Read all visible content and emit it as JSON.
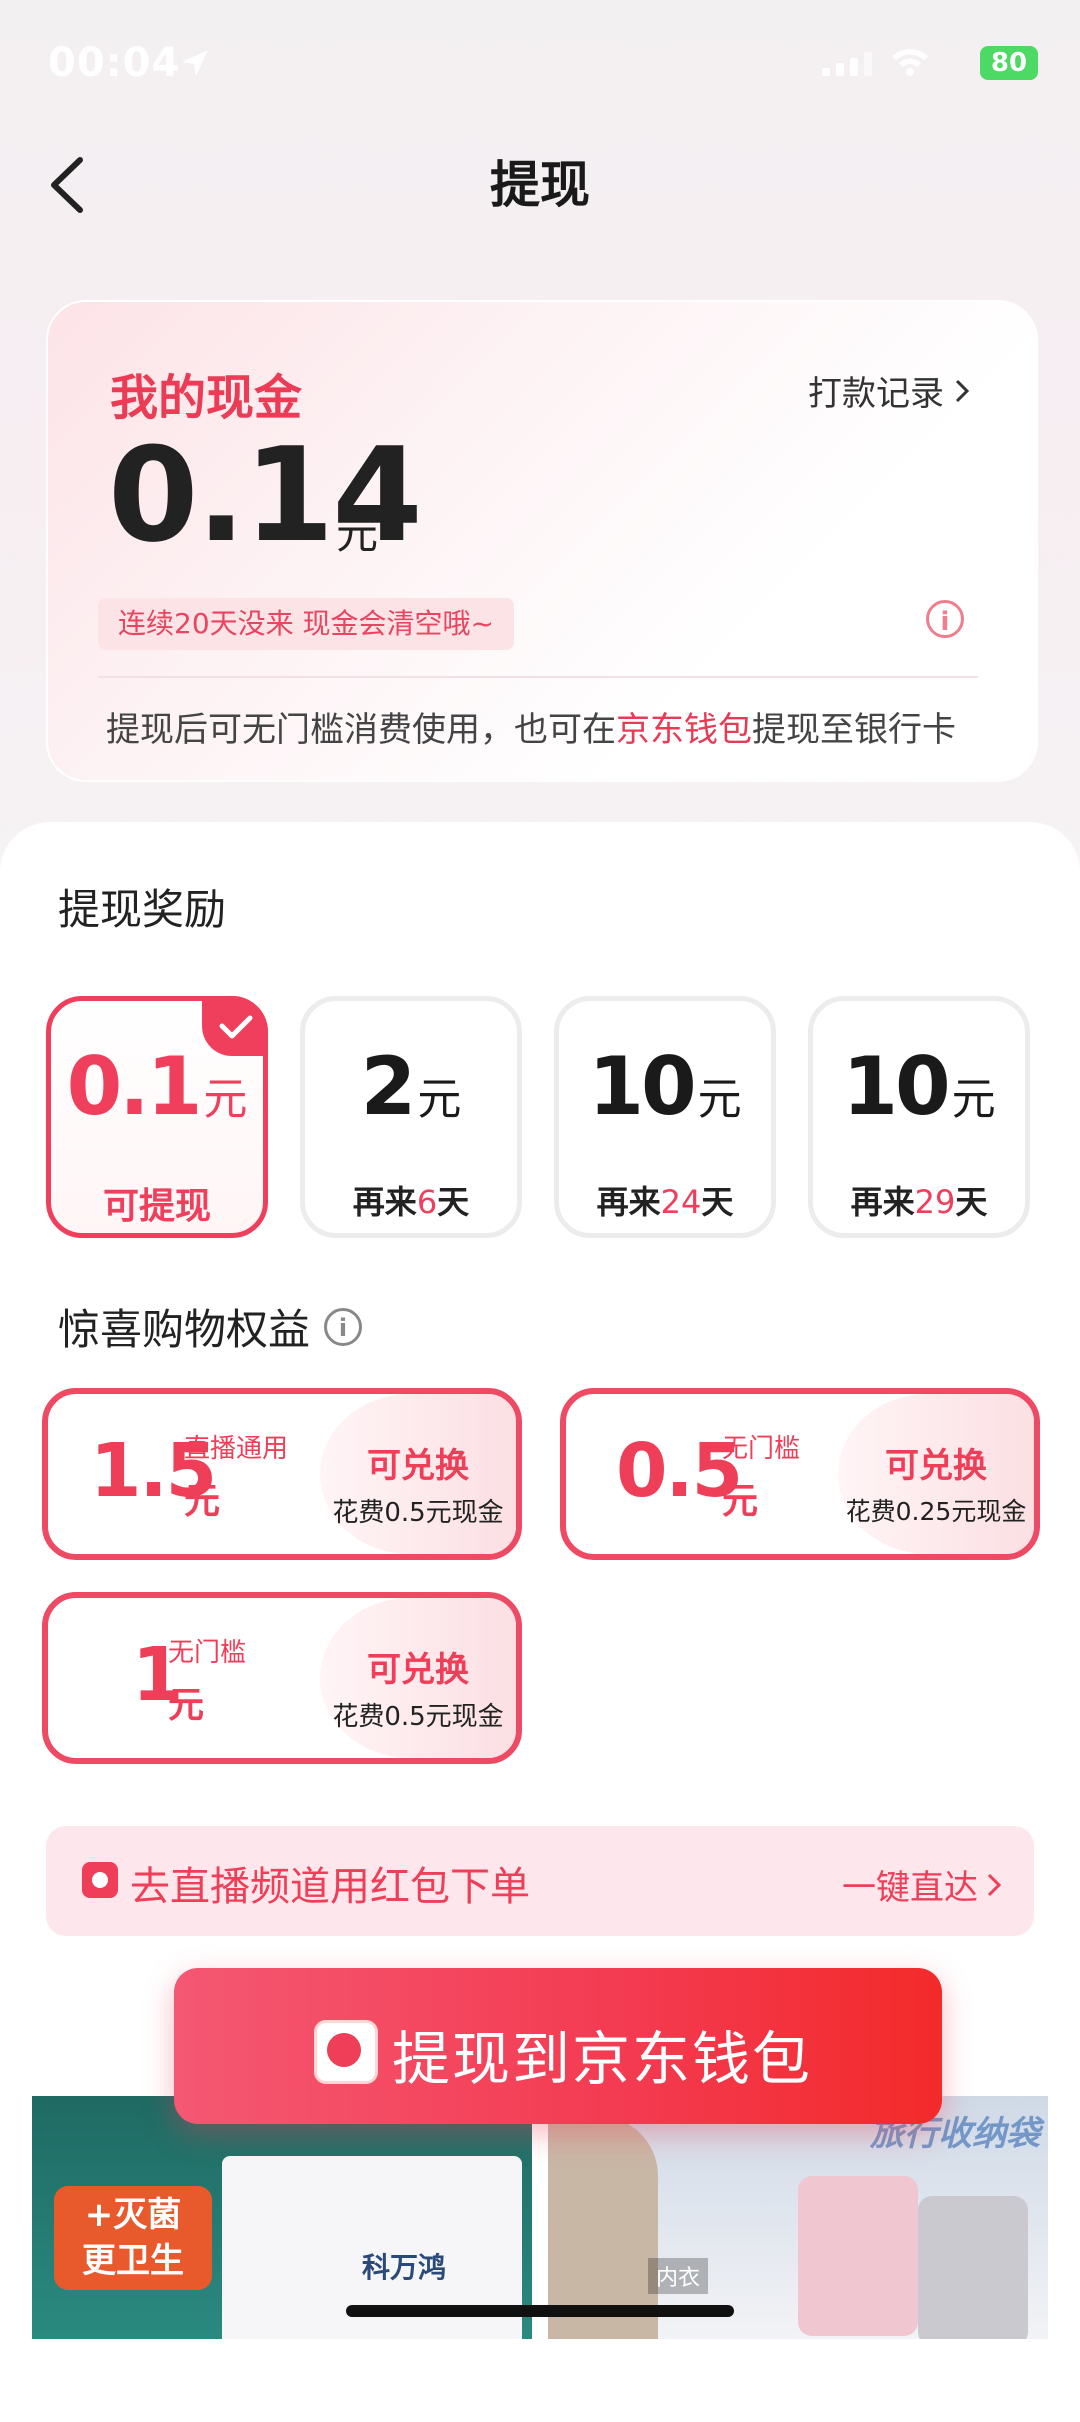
{
  "status_bar": {
    "time": "00:04",
    "battery": "80"
  },
  "header": {
    "title": "提现"
  },
  "cash_card": {
    "title": "我的现金",
    "record_link": "打款记录",
    "amount": "0.14",
    "unit": "元",
    "warning": "连续20天没来 现金会清空哦~",
    "note_prefix": "提现后可无门槛消费使用，也可在",
    "note_highlight": "京东钱包",
    "note_suffix": "提现至银行卡"
  },
  "rewards": {
    "title": "提现奖励",
    "tiers": [
      {
        "amount": "0.1",
        "unit": "元",
        "label": "可提现"
      },
      {
        "amount": "2",
        "unit": "元",
        "pre": "再来",
        "days": "6",
        "post": "天"
      },
      {
        "amount": "10",
        "unit": "元",
        "pre": "再来",
        "days": "24",
        "post": "天"
      },
      {
        "amount": "10",
        "unit": "元",
        "pre": "再来",
        "days": "29",
        "post": "天"
      }
    ]
  },
  "benefits": {
    "title": "惊喜购物权益",
    "coupons": [
      {
        "value": "1.5",
        "tag": "直播通用",
        "unit": "元",
        "action": "可兑换",
        "cost": "花费0.5元现金"
      },
      {
        "value": "0.5",
        "tag": "无门槛",
        "unit": "元",
        "action": "可兑换",
        "cost": "花费0.25元现金"
      },
      {
        "value": "1",
        "tag": "无门槛",
        "unit": "元",
        "action": "可兑换",
        "cost": "花费0.5元现金"
      }
    ]
  },
  "live_banner": {
    "text": "去直播频道用红包下单",
    "action": "一键直达"
  },
  "withdraw_button": {
    "label": "提现到京东钱包"
  },
  "products": {
    "p1_badge_line1": "+灭菌",
    "p1_badge_line2": "更卫生",
    "p1_brand": "科万鸿",
    "p2_title": "旅行收纳袋",
    "p2_label": "内衣"
  },
  "colors": {
    "accent": "#ee3e58",
    "card_bg": "#fde3e7",
    "button": "#f33a50"
  }
}
